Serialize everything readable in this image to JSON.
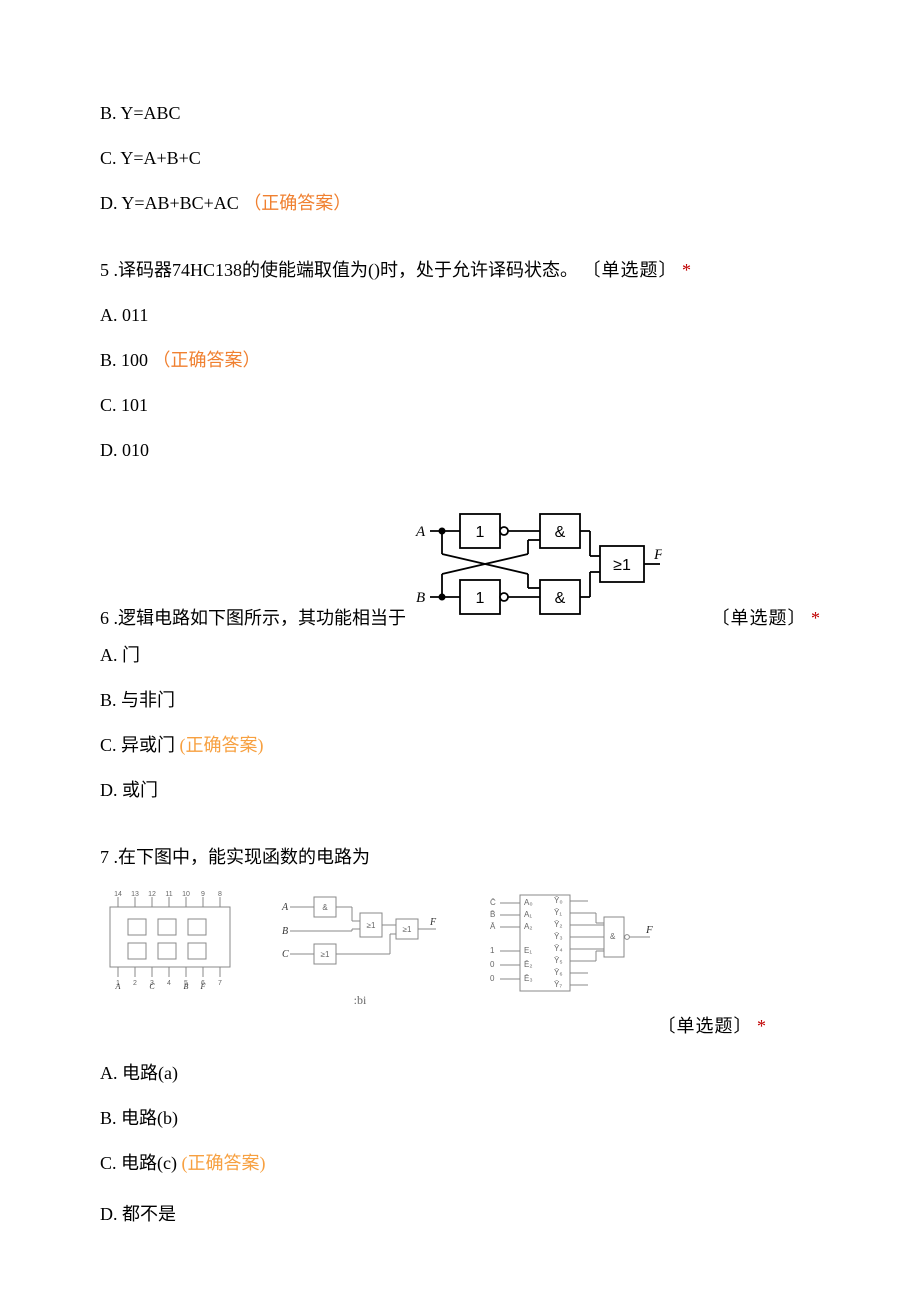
{
  "q4": {
    "options": {
      "b": {
        "label": "B.",
        "text": "  Y=ABC"
      },
      "c": {
        "label": "C.",
        "text": " Y=A+B+C"
      },
      "d": {
        "label": "D.",
        "text": " Y=AB+BC+AC",
        "correct": "（正确答案）"
      }
    }
  },
  "q5": {
    "num": "5",
    "stem": ".译码器74HC138的使能端取值为()时，处于允许译码状态。",
    "qtype": "〔单选题〕",
    "asterisk": "*",
    "options": {
      "a": {
        "label": "A.",
        "text": " 011"
      },
      "b": {
        "label": "B.",
        "text": " 100",
        "correct": "（正确答案）"
      },
      "c": {
        "label": "C.",
        "text": " 101"
      },
      "d": {
        "label": "D.",
        "text": " 010"
      }
    }
  },
  "q6": {
    "num": "6",
    "stem_left": ".逻辑电路如下图所示，其功能相当于",
    "qtype": "〔单选题〕",
    "asterisk": "*",
    "diagram": {
      "inA": "A",
      "inB": "B",
      "outF": "F",
      "not1": "1",
      "not2": "1",
      "and1": "&",
      "and2": "&",
      "or": "≥1"
    },
    "options": {
      "a": {
        "label": "A.",
        "text": " 门"
      },
      "b": {
        "label": "B.",
        "text": " 与非门"
      },
      "c": {
        "label": "C.",
        "text": " 异或门",
        "correct": "(正确答案)"
      },
      "d": {
        "label": "D.",
        "text": " 或门"
      }
    }
  },
  "q7": {
    "num": "7",
    "stem": ".在下图中，能实现函数的电路为",
    "sub_bi": ":bi",
    "qtype": "〔单选题〕",
    "asterisk": "*",
    "diagA": {
      "top": [
        "14",
        "13",
        "12",
        "11",
        "10",
        "9",
        "8"
      ],
      "bottom": [
        "1",
        "2",
        "3",
        "4",
        "5",
        "6",
        "7"
      ],
      "brow": [
        "A",
        "",
        "C",
        "",
        "B",
        "F",
        ""
      ]
    },
    "diagB": {
      "inA": "A",
      "inB": "B",
      "inC": "C",
      "outF": "F",
      "g1": "&",
      "g2": "≥1",
      "g3": "≥1"
    },
    "diagC": {
      "left_inputs": [
        "C̄",
        "B̄",
        "Ā",
        "1",
        "0",
        "0"
      ],
      "left_pins": [
        "A₀",
        "A₁",
        "A₂",
        "E₁",
        "Ē₂",
        "Ē₃"
      ],
      "right_pins": [
        "Ȳ₀",
        "Ȳ₁",
        "Ȳ₂",
        "Ȳ₃",
        "Ȳ₄",
        "Ȳ₅",
        "Ȳ₆",
        "Ȳ₇"
      ],
      "gate": "&",
      "outF": "F"
    },
    "options": {
      "a": {
        "label": "A.",
        "text": " 电路(a)"
      },
      "b": {
        "label": "B.",
        "text": " 电路(b)"
      },
      "c": {
        "label": "C.",
        "text": " 电路(c)",
        "correct": "(正确答案)"
      },
      "d": {
        "label": "D.",
        "text": "   都不是"
      }
    }
  }
}
